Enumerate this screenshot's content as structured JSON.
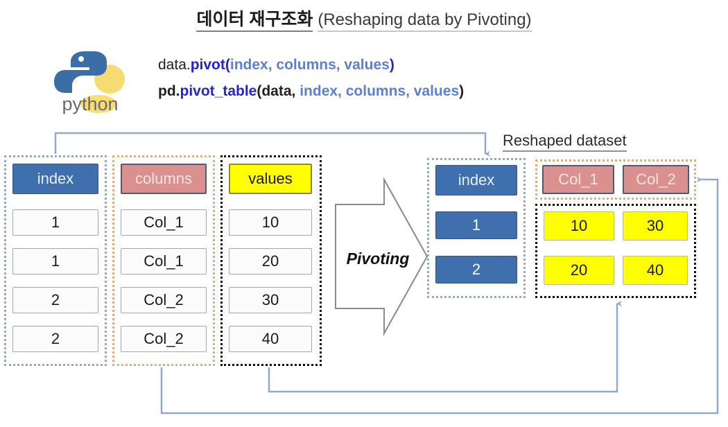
{
  "title": {
    "korean": "데이터 재구조화",
    "english": "(Reshaping data by Pivoting)"
  },
  "logo": {
    "name": "python-logo",
    "wordmark": "python"
  },
  "code": {
    "line1": [
      {
        "text": "data.",
        "style": "plain"
      },
      {
        "text": "pivot",
        "style": "navy"
      },
      {
        "text": "(",
        "style": "navy"
      },
      {
        "text": "index, columns, values",
        "style": "blue"
      },
      {
        "text": ")",
        "style": "navy"
      }
    ],
    "line2": [
      {
        "text": "pd.",
        "style": "dark"
      },
      {
        "text": "pivot_table",
        "style": "navy"
      },
      {
        "text": "(",
        "style": "dark"
      },
      {
        "text": "data,",
        "style": "dark"
      },
      {
        "text": " index, columns, values",
        "style": "blue"
      },
      {
        "text": ")",
        "style": "dark"
      }
    ],
    "line1_plain": "data.pivot(index, columns, values)",
    "line2_plain": "pd.pivot_table(data, index, columns, values)"
  },
  "source_table": {
    "columns": [
      {
        "header": "index",
        "header_style": "blue",
        "group_border": "blue",
        "cells": [
          "1",
          "1",
          "2",
          "2"
        ],
        "cell_style": "white"
      },
      {
        "header": "columns",
        "header_style": "salmon",
        "group_border": "orange",
        "cells": [
          "Col_1",
          "Col_1",
          "Col_2",
          "Col_2"
        ],
        "cell_style": "white"
      },
      {
        "header": "values",
        "header_style": "yellow",
        "group_border": "black",
        "cells": [
          "10",
          "20",
          "30",
          "40"
        ],
        "cell_style": "white"
      }
    ]
  },
  "transform": {
    "label": "Pivoting",
    "arrow_name": "pivoting-block-arrow"
  },
  "reshaped": {
    "label": "Reshaped dataset",
    "index": {
      "header": "index",
      "cells": [
        "1",
        "2"
      ]
    },
    "value_columns": {
      "headers": [
        "Col_1",
        "Col_2"
      ],
      "rows": [
        [
          "10",
          "30"
        ],
        [
          "20",
          "40"
        ]
      ]
    }
  },
  "colors": {
    "blue_fill": "#3f6fad",
    "salmon_fill": "#d9908e",
    "yellow_fill": "#ffff00",
    "connector": "#8faac8",
    "dotted_blue": "#8fa9c9",
    "dotted_orange": "#f0a868",
    "dotted_black": "#111111",
    "code_navy": "#2525cf",
    "code_blue": "#5b7fd4"
  }
}
